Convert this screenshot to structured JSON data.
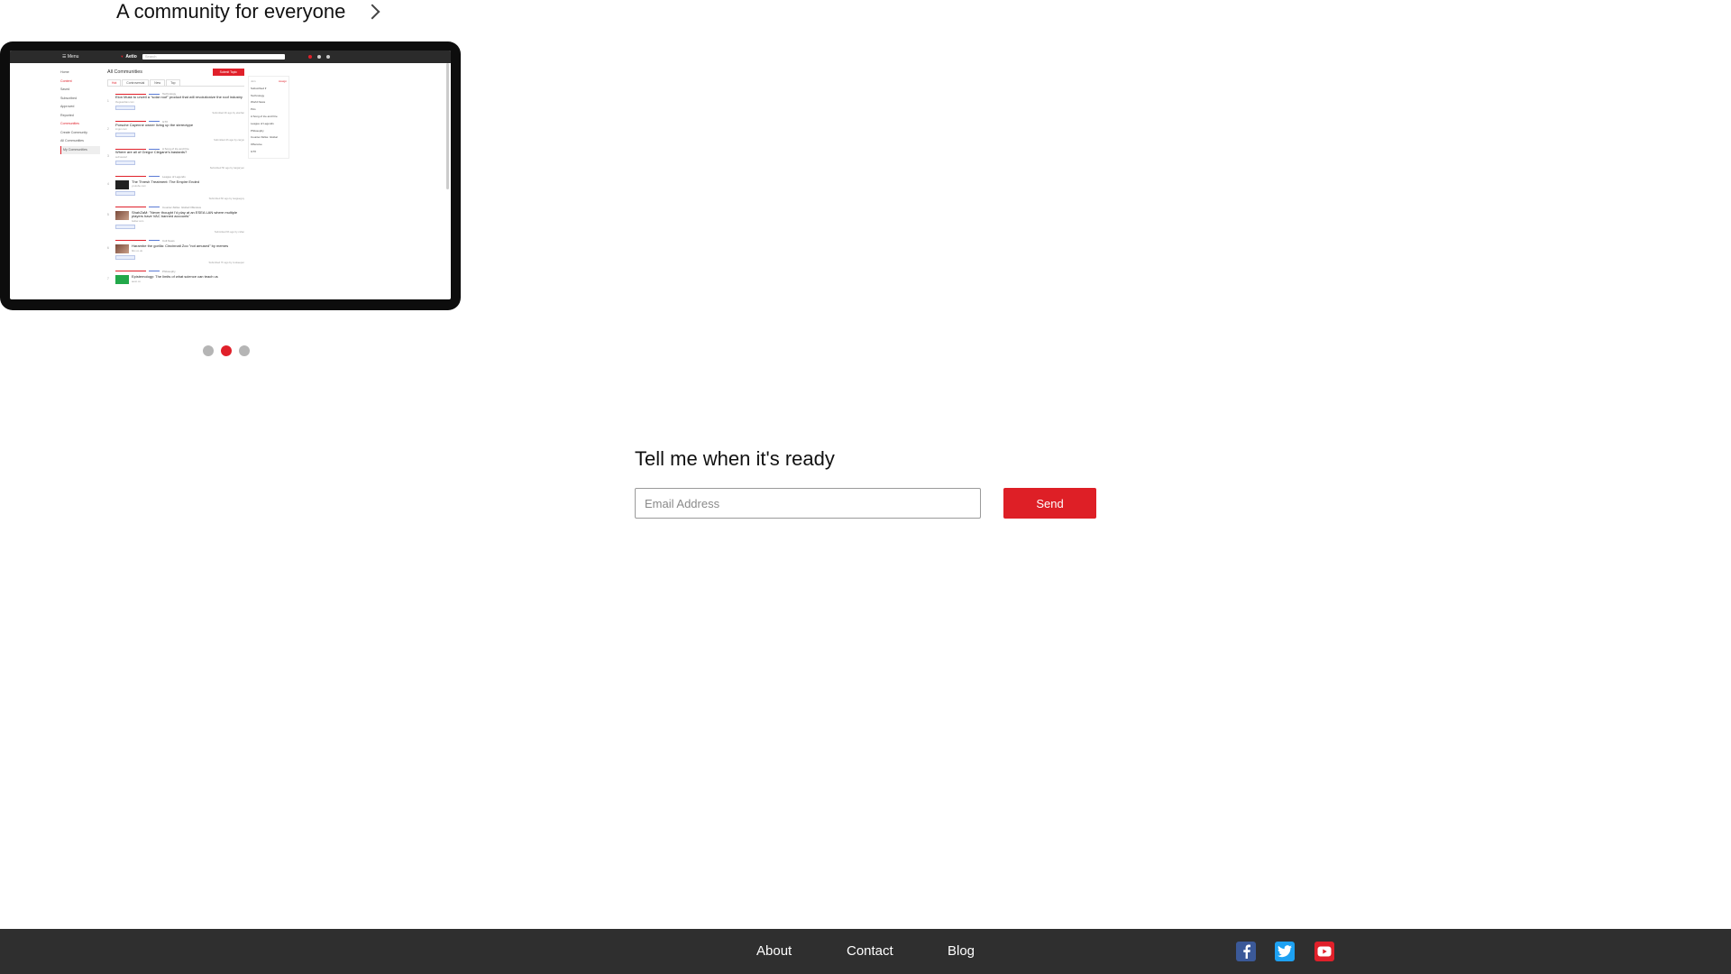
{
  "carousel": {
    "heading": "A community for everyone",
    "dots": [
      {
        "active": false
      },
      {
        "active": true
      },
      {
        "active": false
      }
    ],
    "preview": {
      "topbar": {
        "menu": "☰ Menu",
        "logo": "Aetio",
        "search_placeholder": "Search"
      },
      "sidebar": {
        "home": "Home",
        "section_1": "Content",
        "items_1": [
          "Saved",
          "Subscribed",
          "Approved",
          "Reported"
        ],
        "section_2": "Communities",
        "items_2": [
          "Create Community",
          "All Communities",
          "My Communities"
        ]
      },
      "main": {
        "title": "All Communities",
        "submit_label": "Submit Topic",
        "tabs": [
          "Hot",
          "Controversial",
          "New",
          "Top"
        ],
        "posts": [
          {
            "num": "1",
            "community": "Technology",
            "title": "Elon Musk to unveil a \"solar roof\" product that will revolutionize the roof industry",
            "source": "theguardian.com",
            "meta": "Submitted 3h ago by elonfan"
          },
          {
            "num": "2",
            "community": "GTX",
            "title": "Porsche Cayenne owner living up the stereotype",
            "source": "imgur.com",
            "meta": "Submitted 4h ago by caryjo"
          },
          {
            "num": "3",
            "community": "A Song of Ice and Fire",
            "title": "Where are all of Gregor Clegane's bastards?",
            "source": "self.asoiaf",
            "meta": "Submitted 5h ago by targaryen"
          },
          {
            "num": "4",
            "community": "League of Legends",
            "title": "The Thresh Treatment: The Empire Ended",
            "source": "youtube.com",
            "meta": "Submitted 6h ago by leagueguy"
          },
          {
            "num": "5",
            "community": "Counter-Strike: Global Offensive",
            "title": "ShahZaM: \"Never thought I'd play at an ESEA LAN where multiple players have VAC banned accounts\"",
            "source": "twitter.com",
            "meta": "Submitted 6h ago by csfan"
          },
          {
            "num": "6",
            "community": "Cult News",
            "title": "Harambe the gorilla: Cincinnati Zoo \"not amused\" by memes",
            "source": "bbc.co.uk",
            "meta": "Submitted 7h ago by zookeeper"
          },
          {
            "num": "7",
            "community": "Philosophy",
            "title": "Epistemology: The limits of what science can teach us",
            "source": "aeon.co",
            "meta": ""
          }
        ]
      },
      "right_panel": {
        "header_left": "Join",
        "header_right": "Assign",
        "group": "Subscribed ▾",
        "items": [
          "Technology",
          "World News",
          "Pics",
          "A Song of Ice and Fire",
          "League of Legends",
          "Philosophy",
          "Counter-Strike: Global Offensive",
          "GTX"
        ]
      }
    }
  },
  "signup": {
    "title": "Tell me when it's ready",
    "email_placeholder": "Email Address",
    "email_value": "",
    "send_label": "Send"
  },
  "footer": {
    "links": [
      "About",
      "Contact",
      "Blog"
    ],
    "social": [
      {
        "name": "facebook",
        "icon": "facebook-icon",
        "color": "#3b5998"
      },
      {
        "name": "twitter",
        "icon": "twitter-icon",
        "color": "#1da1f2"
      },
      {
        "name": "youtube",
        "icon": "youtube-icon",
        "color": "#e0202a"
      }
    ]
  },
  "colors": {
    "accent": "#de1f26",
    "footer_bg": "#2f2f2f",
    "dot_inactive": "#b5b5b5"
  }
}
